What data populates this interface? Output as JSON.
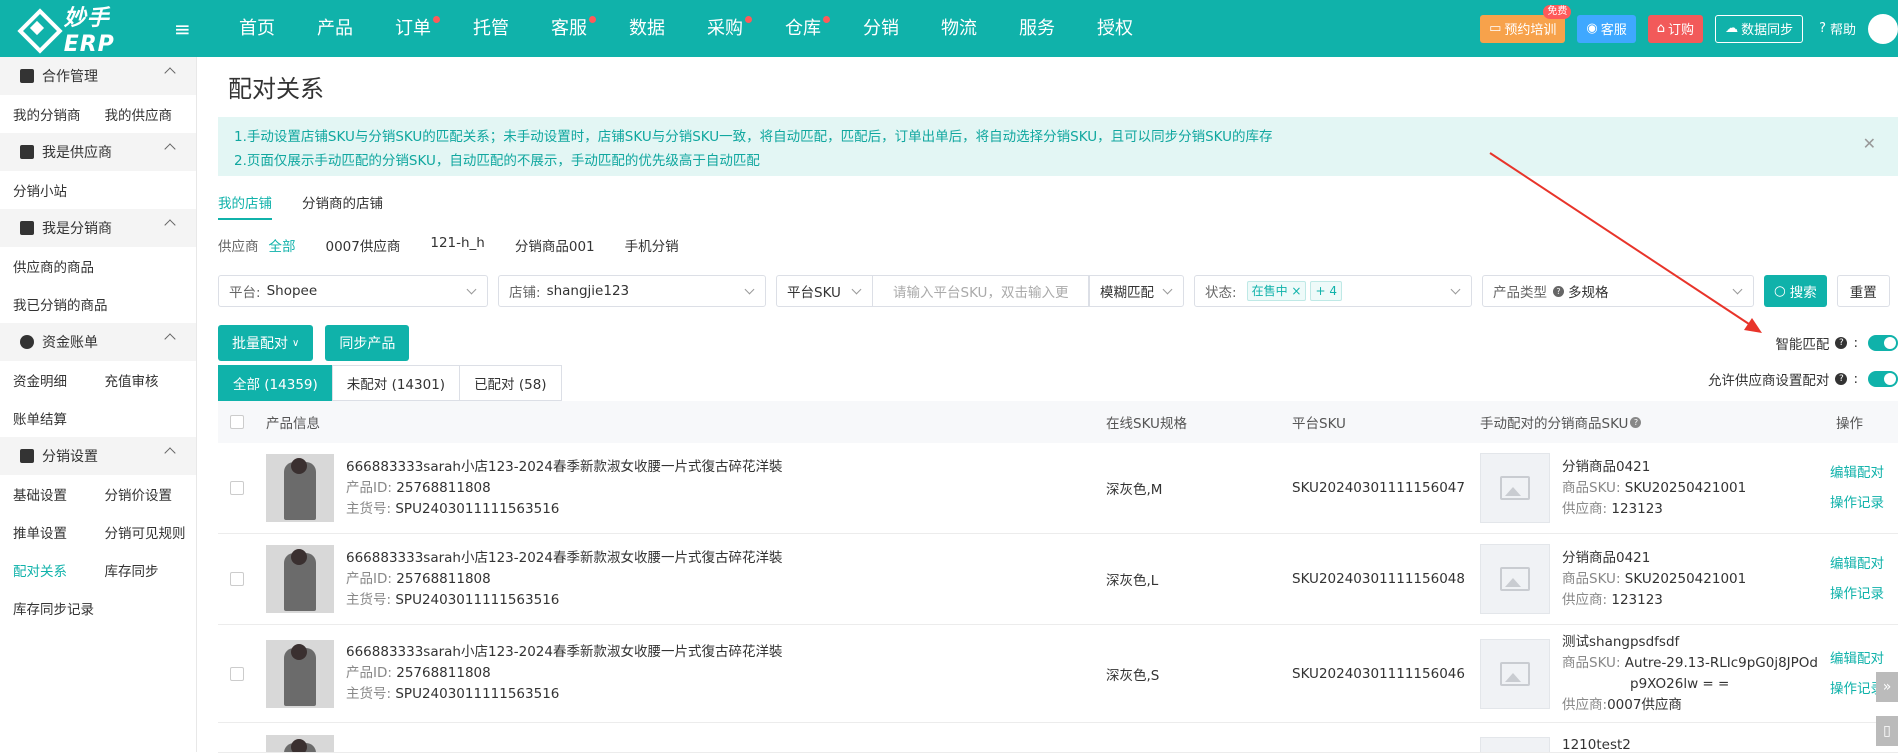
{
  "app": {
    "logo_text": "妙手ERP",
    "brand_color": "#10b2aa"
  },
  "nav": {
    "items": [
      {
        "label": "首页",
        "dot": false
      },
      {
        "label": "产品",
        "dot": false
      },
      {
        "label": "订单",
        "dot": true
      },
      {
        "label": "托管",
        "dot": false
      },
      {
        "label": "客服",
        "dot": true
      },
      {
        "label": "数据",
        "dot": false
      },
      {
        "label": "采购",
        "dot": true
      },
      {
        "label": "仓库",
        "dot": true
      },
      {
        "label": "分销",
        "dot": false
      },
      {
        "label": "物流",
        "dot": false
      },
      {
        "label": "服务",
        "dot": false
      },
      {
        "label": "授权",
        "dot": false
      }
    ],
    "training": "预约培训",
    "training_badge": "免费",
    "service": "客服",
    "subscribe": "订购",
    "sync": "数据同步",
    "help": "帮助"
  },
  "sidebar": {
    "groups": [
      {
        "title": "合作管理",
        "rows": [
          [
            "我的分销商",
            "我的供应商"
          ]
        ]
      },
      {
        "title": "我是供应商",
        "rows": [
          [
            "分销小站"
          ]
        ]
      },
      {
        "title": "我是分销商",
        "rows": [
          [
            "供应商的商品"
          ],
          [
            "我已分销的商品"
          ]
        ]
      },
      {
        "title": "资金账单",
        "rows": [
          [
            "资金明细",
            "充值审核"
          ],
          [
            "账单结算"
          ]
        ]
      },
      {
        "title": "分销设置",
        "rows": [
          [
            "基础设置",
            "分销价设置"
          ],
          [
            "推单设置",
            "分销可见规则"
          ],
          [
            "配对关系",
            "库存同步"
          ],
          [
            "库存同步记录"
          ]
        ]
      }
    ],
    "active": "配对关系"
  },
  "page": {
    "title": "配对关系",
    "notice_1": "1.手动设置店铺SKU与分销SKU的匹配关系；未手动设置时，店铺SKU与分销SKU一致，将自动匹配，匹配后，订单出单后，将自动选择分销SKU，且可以同步分销SKU的库存",
    "notice_2": "2.页面仅展示手动匹配的分销SKU，自动匹配的不展示，手动匹配的优先级高于自动匹配",
    "tab_my_shop": "我的店铺",
    "tab_dist_shop": "分销商的店铺",
    "supplier_label": "供应商",
    "suppliers": [
      "全部",
      "0007供应商",
      "121-h_h",
      "分销商品001",
      "手机分销"
    ]
  },
  "filters": {
    "platform_label": "平台:",
    "platform_value": "Shopee",
    "shop_label": "店铺:",
    "shop_value": "shangjie123",
    "sku_type": "平台SKU",
    "sku_placeholder": "请输入平台SKU，双击输入更",
    "match_mode": "模糊匹配",
    "status_label": "状态:",
    "status_tag": "在售中",
    "status_more": "+ 4",
    "product_type_label": "产品类型",
    "product_type_value": "多规格",
    "search": "搜索",
    "reset": "重置"
  },
  "actions": {
    "batch_pair": "批量配对",
    "sync_product": "同步产品",
    "smart_match": "智能匹配",
    "allow_supplier": "允许供应商设置配对"
  },
  "tabs": [
    {
      "label": "全部 (14359)",
      "active": true
    },
    {
      "label": "未配对 (14301)",
      "active": false
    },
    {
      "label": "已配对 (58)",
      "active": false
    }
  ],
  "table": {
    "headers": [
      "产品信息",
      "在线SKU规格",
      "平台SKU",
      "手动配对的分销商品SKU",
      "操作"
    ],
    "id_label": "产品ID:",
    "spu_label": "主货号:",
    "sku_label": "商品SKU:",
    "supplier_label": "供应商:",
    "op_edit": "编辑配对",
    "op_log": "操作记录",
    "rows": [
      {
        "title": "666883333sarah小店123-2024春季新款淑女收腰一片式復古碎花洋裝",
        "id": "25768811808",
        "spu": "SPU2403011111563516",
        "spec": "深灰色,M",
        "platform_sku": "SKU20240301111156047",
        "dist_name": "分销商品0421",
        "dist_sku": "SKU20250421001",
        "dist_supplier": "123123"
      },
      {
        "title": "666883333sarah小店123-2024春季新款淑女收腰一片式復古碎花洋裝",
        "id": "25768811808",
        "spu": "SPU2403011111563516",
        "spec": "深灰色,L",
        "platform_sku": "SKU20240301111156048",
        "dist_name": "分销商品0421",
        "dist_sku": "SKU20250421001",
        "dist_supplier": "123123"
      },
      {
        "title": "666883333sarah小店123-2024春季新款淑女收腰一片式復古碎花洋裝",
        "id": "25768811808",
        "spu": "SPU2403011111563516",
        "spec": "深灰色,S",
        "platform_sku": "SKU20240301111156046",
        "dist_name": "测试shangpsdfsdf",
        "dist_sku": "Autre-29.13-RLIc9pG0j8JPOd",
        "dist_sku_2": "p9XO26lw = =",
        "dist_supplier": "0007供应商"
      }
    ],
    "partial_next": "1210test2"
  }
}
